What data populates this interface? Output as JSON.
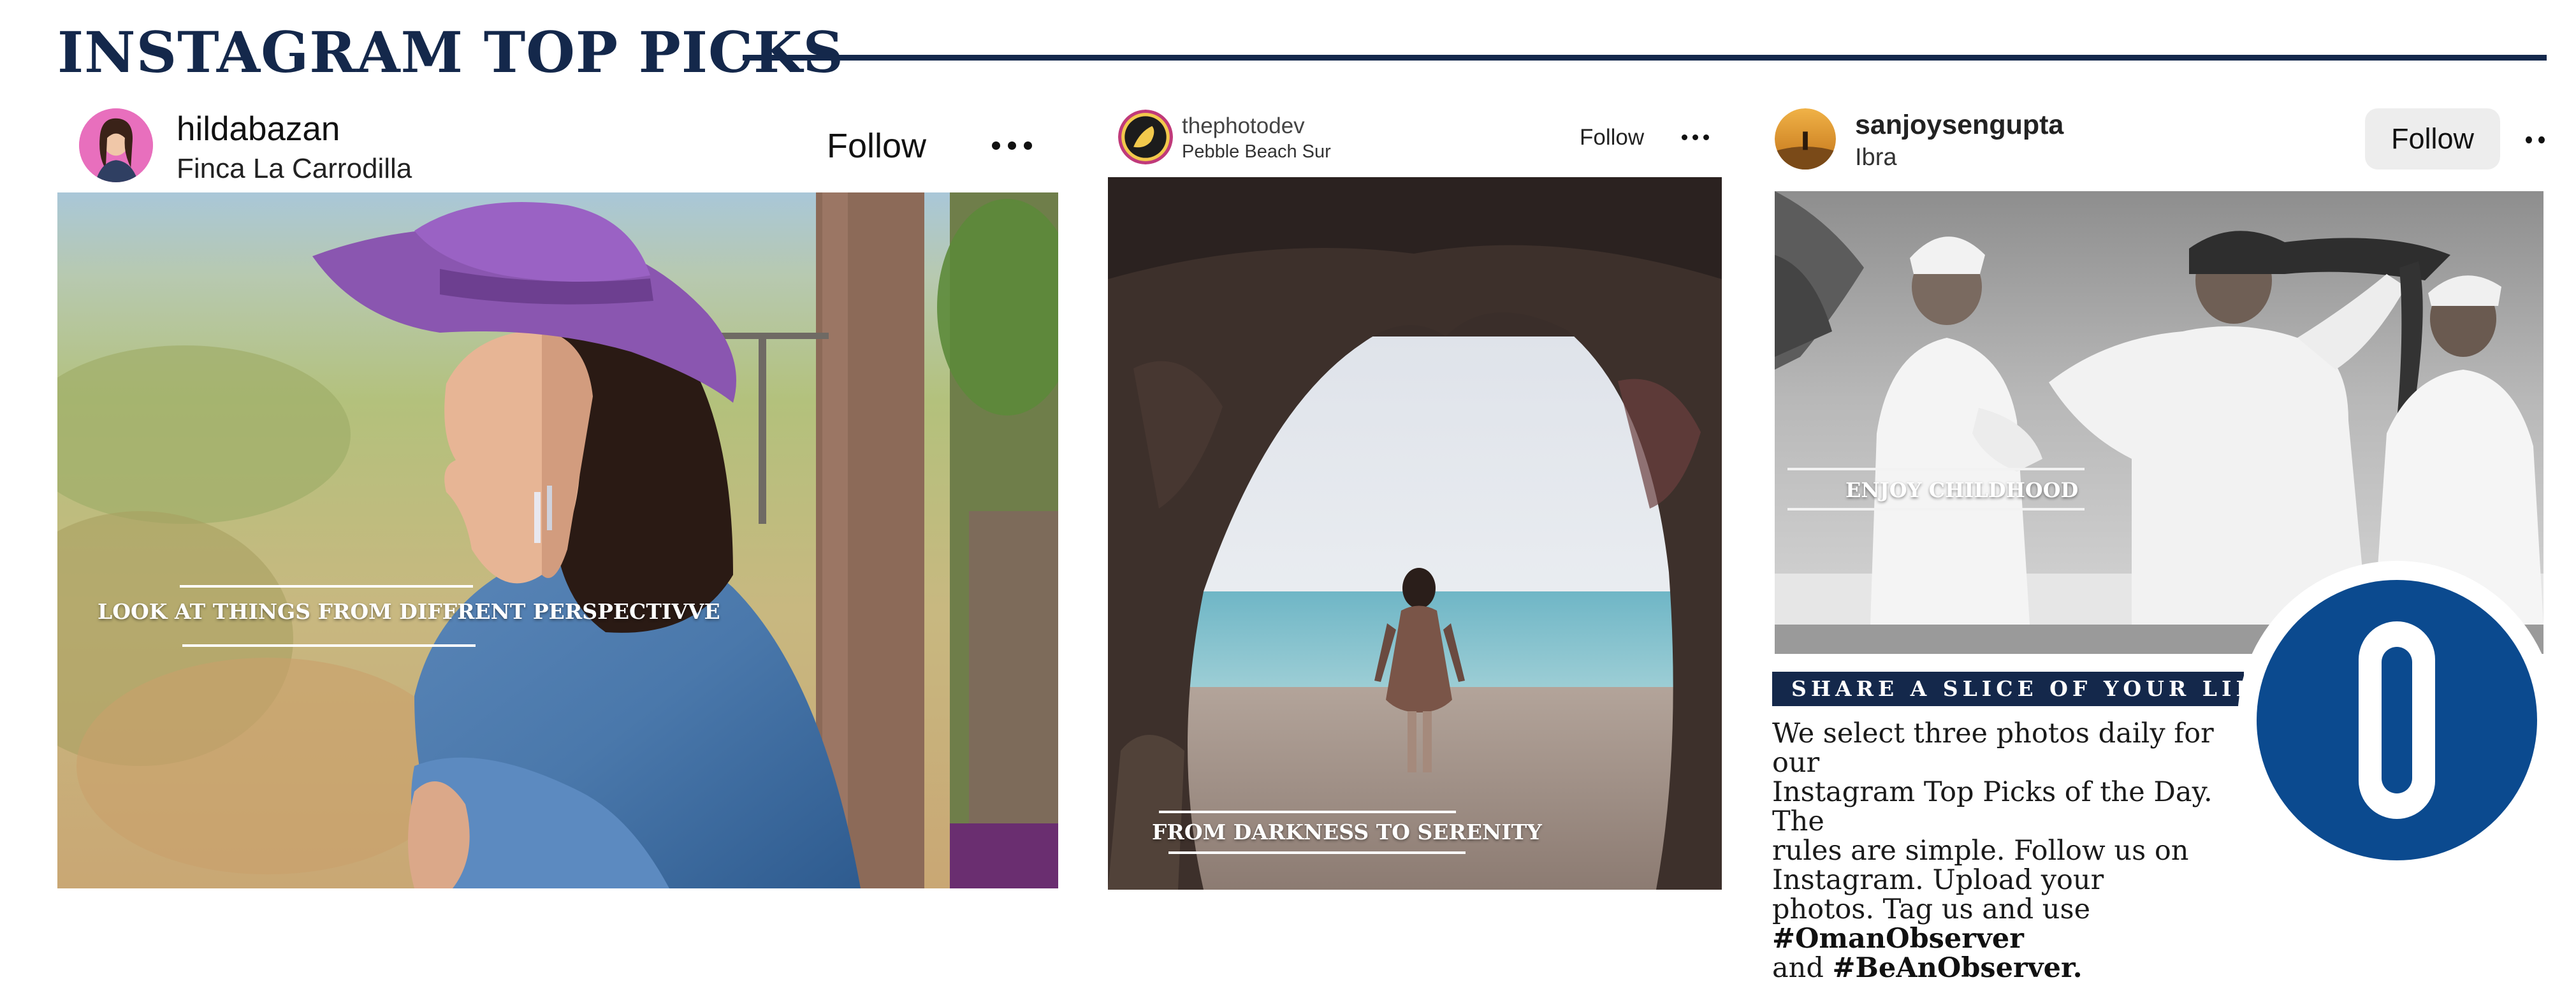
{
  "page": {
    "title": "INSTAGRAM TOP PICKS"
  },
  "posts": [
    {
      "username": "hildabazan",
      "location": "Finca La Carrodilla",
      "follow_label": "Follow",
      "caption": "LOOK AT THINGS FROM DIFFRENT PERSPECTIVVE"
    },
    {
      "username": "thephotodev",
      "location": "Pebble Beach Sur",
      "follow_label": "Follow",
      "caption": "FROM DARKNESS TO SERENITY"
    },
    {
      "username": "sanjoysengupta",
      "location": "Ibra",
      "follow_label": "Follow",
      "caption": "ENJOY CHILDHOOD"
    }
  ],
  "promo": {
    "banner": "SHARE A SLICE OF YOUR LIFE",
    "text_lines": [
      "We select three photos daily for our",
      "Instagram Top Picks of the Day. The",
      "rules are simple. Follow us on",
      "Instagram. Upload your"
    ],
    "text_line5_plain": "photos. Tag us and use ",
    "hashtag1": "#OmanObserver",
    "text_line6_plain": "and ",
    "hashtag2": "#BeAnObserver."
  },
  "logo": {
    "icon": "observer-o-logo",
    "color": "#0b4a8f"
  },
  "colors": {
    "navy": "#14284b",
    "logo_blue": "#0b4a8f"
  }
}
